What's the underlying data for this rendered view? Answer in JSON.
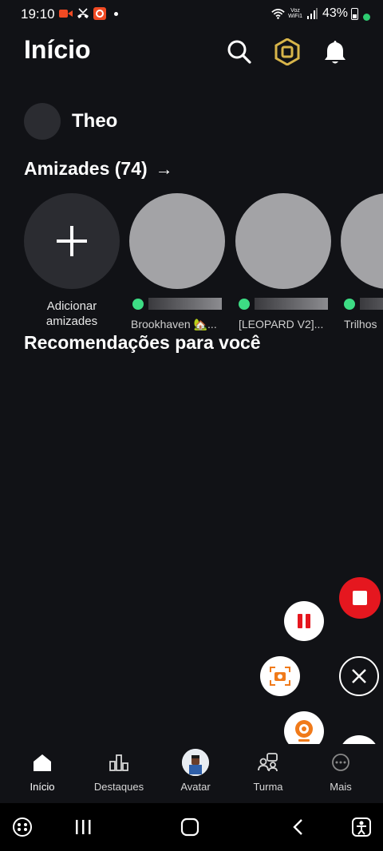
{
  "status_bar": {
    "time": "19:10",
    "voz_top": "Voz",
    "voz_bottom": "WiFi1",
    "battery": "43%"
  },
  "header": {
    "title": "Início",
    "icons": [
      "search-icon",
      "robux-icon",
      "bell-icon"
    ]
  },
  "profile": {
    "name": "Theo"
  },
  "friends": {
    "title": "Amizades (74)",
    "arrow": "→",
    "add_label": "Adicionar amizades",
    "items": [
      {
        "game": "Brookhaven 🏡..."
      },
      {
        "game": "[LEOPARD V2]..."
      },
      {
        "game": "Trilhos"
      }
    ]
  },
  "recommendations": {
    "title": "Recomendações para você"
  },
  "bottom_nav": {
    "items": [
      {
        "label": "Início",
        "icon": "home-icon"
      },
      {
        "label": "Destaques",
        "icon": "chart-icon"
      },
      {
        "label": "Avatar",
        "icon": "avatar-icon"
      },
      {
        "label": "Turma",
        "icon": "group-icon"
      },
      {
        "label": "Mais",
        "icon": "more-icon"
      }
    ]
  },
  "colors": {
    "background": "#111216",
    "online": "#3ddc84",
    "record_red": "#e5171f",
    "recorder_orange": "#f07a1a"
  }
}
